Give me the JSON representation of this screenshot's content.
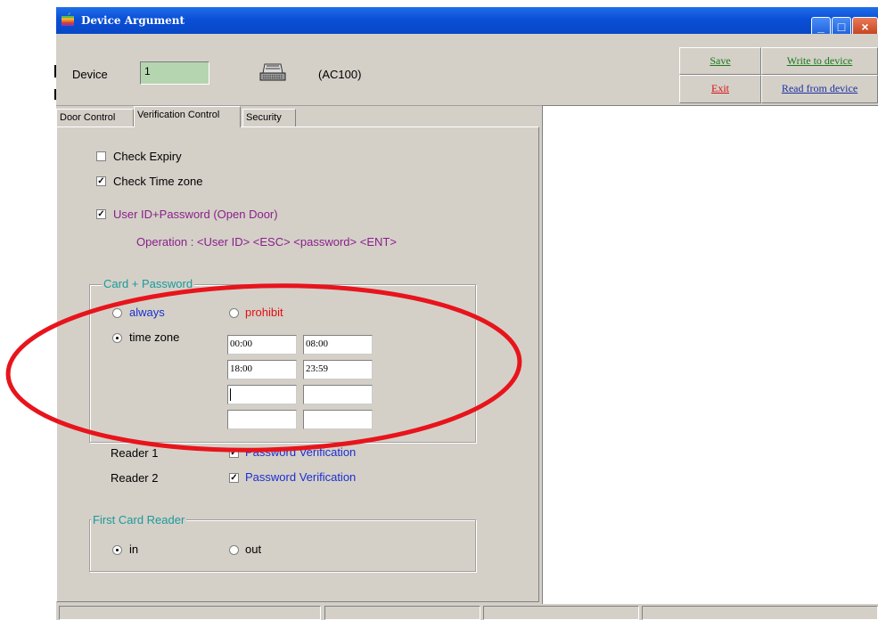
{
  "window": {
    "title": "Device Argument"
  },
  "header": {
    "device_label": "Device",
    "device_value": "1",
    "device_model": "(AC100)",
    "buttons": {
      "save": "Save",
      "write": "Write to device",
      "exit": "Exit",
      "read": "Read from device"
    }
  },
  "tabs": [
    {
      "label": "Door Control"
    },
    {
      "label": "Verification Control"
    },
    {
      "label": "Security"
    }
  ],
  "verification": {
    "check_expiry": {
      "label": "Check Expiry",
      "checked": false
    },
    "check_time_zone": {
      "label": "Check Time zone",
      "checked": true
    },
    "userid_password": {
      "label": "User ID+Password (Open Door)",
      "checked": true
    },
    "operation": "Operation : <User ID> <ESC> <password> <ENT>"
  },
  "card_password": {
    "legend": "Card + Password",
    "always": "always",
    "prohibit": "prohibit",
    "time_zone": "time zone",
    "selected": "time zone",
    "time_fields": [
      [
        "00:00",
        "08:00"
      ],
      [
        "18:00",
        "23:59"
      ],
      [
        "",
        ""
      ],
      [
        "",
        ""
      ]
    ],
    "reader1": {
      "label": "Reader 1",
      "check_label": "Password Verification",
      "checked": true
    },
    "reader2": {
      "label": "Reader 2",
      "check_label": "Password Verification",
      "checked": true
    }
  },
  "first_card_reader": {
    "legend": "First Card Reader",
    "in": "in",
    "out": "out",
    "selected": "in"
  },
  "colors": {
    "title_blue": "#0a4fd8",
    "annotation_red": "#e8141c",
    "purple_text": "#8a1f8a",
    "blue_text": "#1b2fd0",
    "red_text": "#e01010",
    "teal_legend": "#1a9a9a",
    "device_field_green": "#b5d5b0"
  }
}
